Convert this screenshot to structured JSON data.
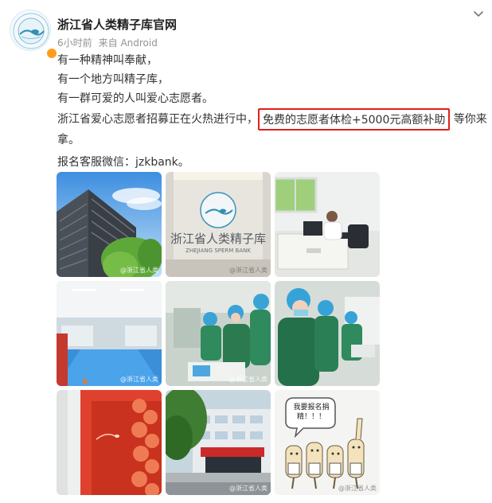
{
  "author": {
    "name": "浙江省人类精子库官网",
    "time": "6小时前",
    "source": "来自 Android",
    "avatar_icon": "sperm-bank-logo-icon",
    "verified_icon": "verified-badge-icon"
  },
  "menu_icon": "chevron-down-icon",
  "content": {
    "line1": "有一种精神叫奉献，",
    "line2": "有一个地方叫精子库，",
    "line3": "有一群可爱的人叫爱心志愿者。",
    "line4_prefix": "浙江省爱心志愿者招募正在火热进行中，",
    "line4_highlight": "免费的志愿者体检+5000元高额补助",
    "line4_suffix": "等你来",
    "line5": "拿。",
    "line6": "报名客服微信：jzkbank。"
  },
  "images": {
    "img2_sign_cn": "浙江省人类精子库",
    "img2_sign_en": "ZHEJIANG SPERM BANK",
    "img9_bubble": "我要报名捐精！！！",
    "watermark": "@浙江省人类"
  },
  "colors": {
    "highlight_border": "#e0201b",
    "verified": "#ff9d1a",
    "meta": "#939393"
  }
}
